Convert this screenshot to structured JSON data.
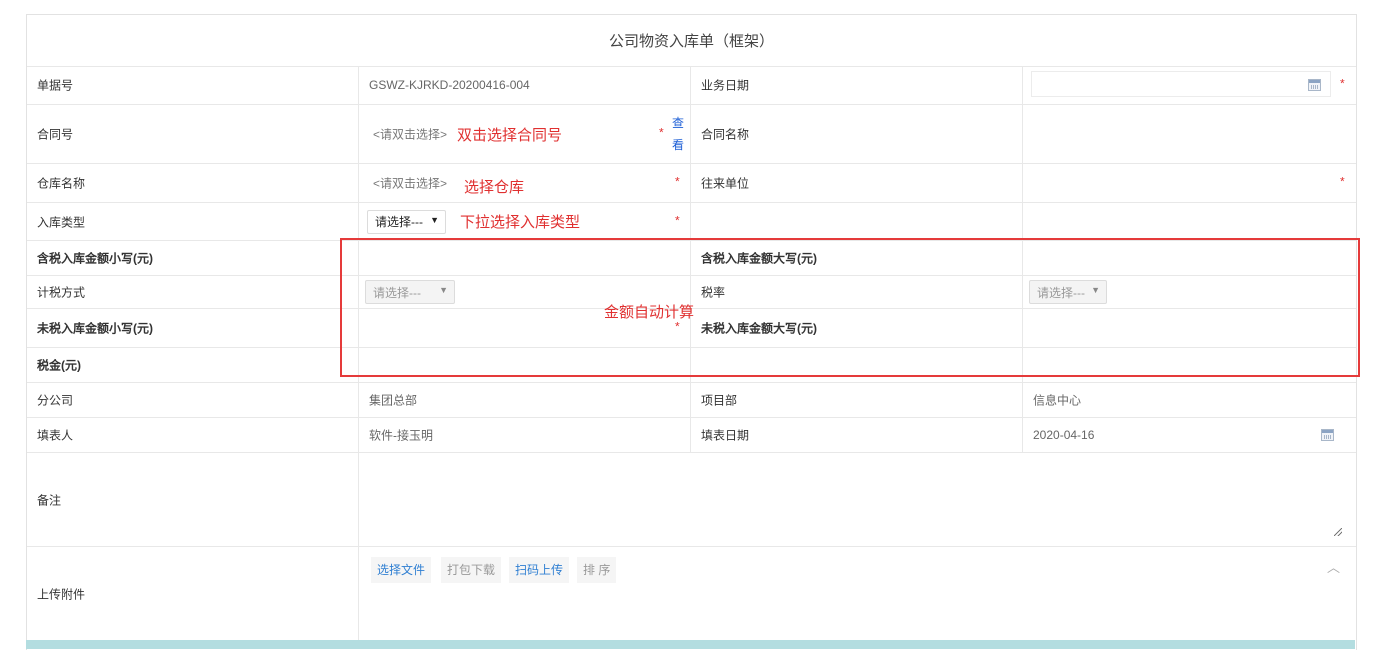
{
  "form": {
    "title": "公司物资入库单（框架）",
    "required_mark": "*",
    "view_link": "查看",
    "fields": {
      "doc_no_label": "单据号",
      "doc_no_value": "GSWZ-KJRKD-20200416-004",
      "biz_date_label": "业务日期",
      "biz_date_value": "",
      "contract_no_label": "合同号",
      "contract_no_placeholder": "<请双击选择>",
      "contract_name_label": "合同名称",
      "warehouse_label": "仓库名称",
      "warehouse_placeholder": "<请双击选择>",
      "partner_label": "往来单位",
      "stock_type_label": "入库类型",
      "stock_type_value": "请选择---",
      "tax_incl_small_label": "含税入库金额小写(元)",
      "tax_incl_big_label": "含税入库金额大写(元)",
      "tax_method_label": "计税方式",
      "tax_method_value": "请选择---",
      "tax_rate_label": "税率",
      "tax_rate_value": "请选择---",
      "tax_excl_small_label": "未税入库金额小写(元)",
      "tax_excl_big_label": "未税入库金额大写(元)",
      "tax_amount_label": "税金(元)",
      "branch_label": "分公司",
      "branch_value": "集团总部",
      "project_label": "项目部",
      "project_value": "信息中心",
      "filler_label": "填表人",
      "filler_value": "软件-接玉明",
      "fill_date_label": "填表日期",
      "fill_date_value": "2020-04-16",
      "remark_label": "备注",
      "attach_label": "上传附件"
    },
    "attach_buttons": {
      "choose_file": "选择文件",
      "download_pack": "打包下载",
      "scan_upload": "扫码上传",
      "sort": "排 序"
    }
  },
  "annotations": {
    "contract": "双击选择合同号",
    "warehouse": "选择仓库",
    "stock_type": "下拉选择入库类型",
    "amount": "金额自动计算"
  },
  "colors": {
    "required": "#e03030",
    "annotation_box": "#e53a3a",
    "link": "#1e5fd6",
    "footer_bar": "#b3dde0"
  }
}
